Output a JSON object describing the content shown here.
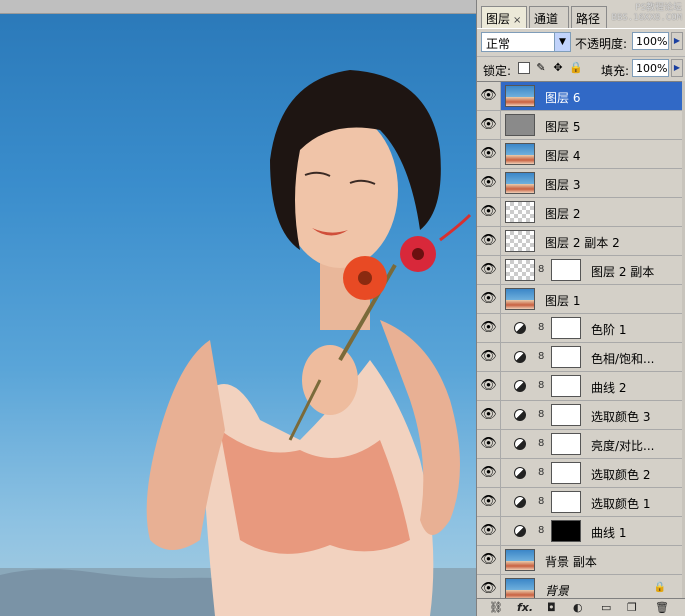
{
  "panel": {
    "tabs": [
      {
        "label": "图层",
        "close": "×",
        "active": true
      },
      {
        "label": "通道",
        "active": false
      },
      {
        "label": "路径",
        "active": false
      }
    ],
    "watermark": [
      "PS教程论坛",
      "BBS.16XX8.COM"
    ],
    "blend_mode": "正常",
    "opacity_label": "不透明度:",
    "opacity_value": "100%",
    "lock_label": "锁定:",
    "fill_label": "填充:",
    "fill_value": "100%"
  },
  "layers": [
    {
      "name": "图层 6",
      "thumb": "photo",
      "selected": true
    },
    {
      "name": "图层 5",
      "thumb": "gray"
    },
    {
      "name": "图层 4",
      "thumb": "photo"
    },
    {
      "name": "图层 3",
      "thumb": "photo"
    },
    {
      "name": "图层 2",
      "thumb": "checker"
    },
    {
      "name": "图层 2 副本 2",
      "thumb": "checker"
    },
    {
      "name": "图层 2 副本",
      "thumb": "checker",
      "mask": "mask-stroke"
    },
    {
      "name": "图层 1",
      "thumb": "photo"
    },
    {
      "name": "色阶 1",
      "adjustment": true,
      "mask": "white"
    },
    {
      "name": "色相/饱和...",
      "adjustment": true,
      "mask": "white"
    },
    {
      "name": "曲线 2",
      "adjustment": true,
      "mask": "white"
    },
    {
      "name": "选取颜色 3",
      "adjustment": true,
      "mask": "white"
    },
    {
      "name": "亮度/对比...",
      "adjustment": true,
      "mask": "white"
    },
    {
      "name": "选取颜色 2",
      "adjustment": true,
      "mask": "white"
    },
    {
      "name": "选取颜色 1",
      "adjustment": true,
      "mask": "white"
    },
    {
      "name": "曲线 1",
      "adjustment": true,
      "mask": "black"
    },
    {
      "name": "背景 副本",
      "thumb": "photo"
    },
    {
      "name": "背景",
      "thumb": "photo",
      "italic": true,
      "locked": true
    }
  ],
  "toolbar": {
    "icons": [
      "link-icon",
      "fx-icon",
      "mask-icon",
      "adjustment-icon",
      "folder-icon",
      "new-layer-icon",
      "trash-icon"
    ]
  }
}
